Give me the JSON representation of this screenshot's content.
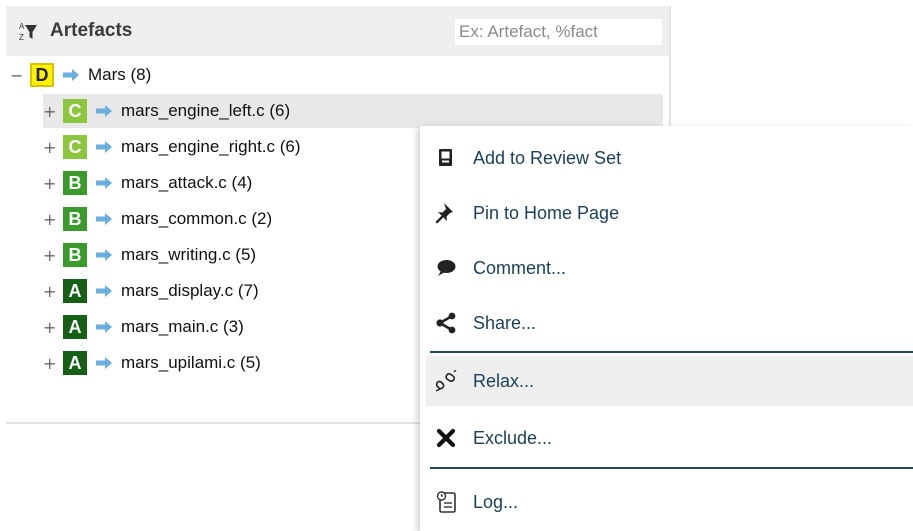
{
  "panel": {
    "title": "Artefacts",
    "filter_placeholder": "Ex: Artefact, %fact"
  },
  "tree": {
    "root": {
      "toggle": "−",
      "grade": "D",
      "label": "Mars (8)"
    },
    "children": [
      {
        "toggle": "+",
        "grade": "C",
        "label": "mars_engine_left.c (6)",
        "selected": true
      },
      {
        "toggle": "+",
        "grade": "C",
        "label": "mars_engine_right.c (6)"
      },
      {
        "toggle": "+",
        "grade": "B",
        "label": "mars_attack.c (4)"
      },
      {
        "toggle": "+",
        "grade": "B",
        "label": "mars_common.c (2)"
      },
      {
        "toggle": "+",
        "grade": "B",
        "label": "mars_writing.c (5)"
      },
      {
        "toggle": "+",
        "grade": "A",
        "label": "mars_display.c (7)"
      },
      {
        "toggle": "+",
        "grade": "A",
        "label": "mars_main.c (3)"
      },
      {
        "toggle": "+",
        "grade": "A",
        "label": "mars_upilami.c (5)"
      }
    ]
  },
  "colors": {
    "grade_D": "#fff200",
    "grade_C": "#8cc63e",
    "grade_B": "#3a9b2c",
    "grade_A": "#155f17",
    "arrow": "#6aaee0",
    "menu_text": "#1a3f5a"
  },
  "context_menu": {
    "items": [
      {
        "label": "Add to Review Set",
        "icon": "review-set-icon"
      },
      {
        "label": "Pin to Home Page",
        "icon": "pin-icon"
      },
      {
        "label": "Comment...",
        "icon": "comment-icon"
      },
      {
        "label": "Share...",
        "icon": "share-icon"
      },
      {
        "label": "Relax...",
        "icon": "relax-icon",
        "highlighted": true
      },
      {
        "label": "Exclude...",
        "icon": "exclude-icon"
      },
      {
        "label": "Log...",
        "icon": "log-icon"
      }
    ]
  }
}
